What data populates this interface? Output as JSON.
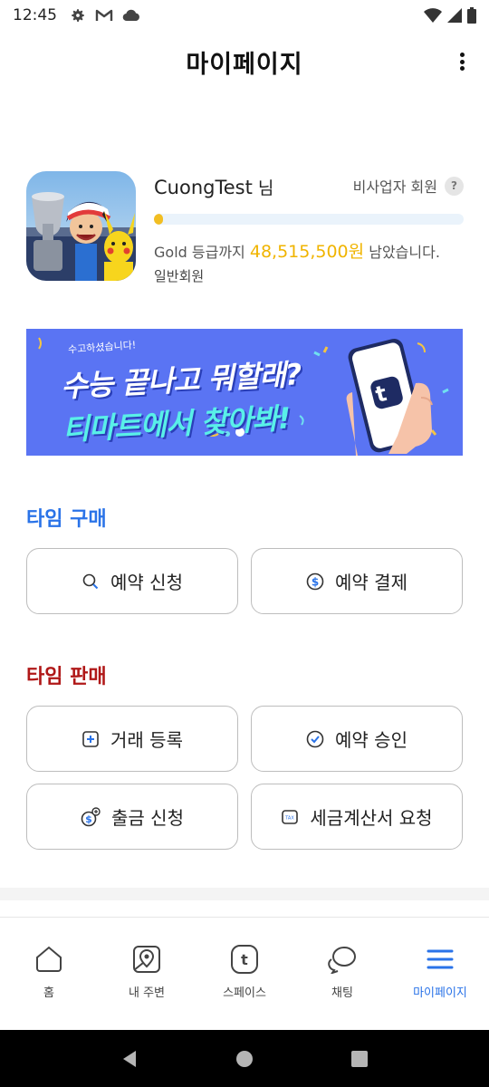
{
  "status_bar": {
    "time": "12:45",
    "left_icons": [
      "gear-icon",
      "gmail-icon",
      "cloud-icon"
    ],
    "right_icons": [
      "wifi-icon",
      "signal-icon",
      "battery-icon"
    ]
  },
  "header": {
    "title": "마이페이지",
    "menu_icon": "more-vertical-icon"
  },
  "profile": {
    "name": "CuongTest",
    "name_suffix": "님",
    "member_type": "비사업자 회원",
    "help_symbol": "?",
    "progress_fraction": 0.03,
    "grade_prefix": "Gold 등급까지",
    "grade_amount": "48,515,500원",
    "grade_suffix": "남았습니다.",
    "grade_level": "일반회원"
  },
  "banner": {
    "small_text": "수고하셨습니다!",
    "line1": "수능 끝나고 뭐할래?",
    "line2": "티마트에서 찾아봐!",
    "phone_letter": "t"
  },
  "buy_section": {
    "title": "타임 구매",
    "buttons": [
      {
        "label": "예약 신청",
        "icon": "search-icon"
      },
      {
        "label": "예약 결제",
        "icon": "dollar-circle-icon"
      }
    ]
  },
  "sell_section": {
    "title": "타임 판매",
    "buttons": [
      {
        "label": "거래 등록",
        "icon": "plus-square-icon"
      },
      {
        "label": "예약 승인",
        "icon": "check-circle-icon"
      },
      {
        "label": "출금 신청",
        "icon": "withdraw-icon"
      },
      {
        "label": "세금계산서 요청",
        "icon": "tax-icon"
      }
    ]
  },
  "bottom_nav": {
    "items": [
      {
        "label": "홈",
        "icon": "home-icon",
        "active": false
      },
      {
        "label": "내 주변",
        "icon": "map-pin-icon",
        "active": false
      },
      {
        "label": "스페이스",
        "icon": "space-t-icon",
        "active": false
      },
      {
        "label": "채팅",
        "icon": "chat-icon",
        "active": false
      },
      {
        "label": "마이페이지",
        "icon": "menu-icon",
        "active": true
      }
    ]
  },
  "colors": {
    "accent_blue": "#2a73e8",
    "accent_red": "#b01818",
    "gold": "#f0b400",
    "banner_bg": "#5a74f3"
  }
}
